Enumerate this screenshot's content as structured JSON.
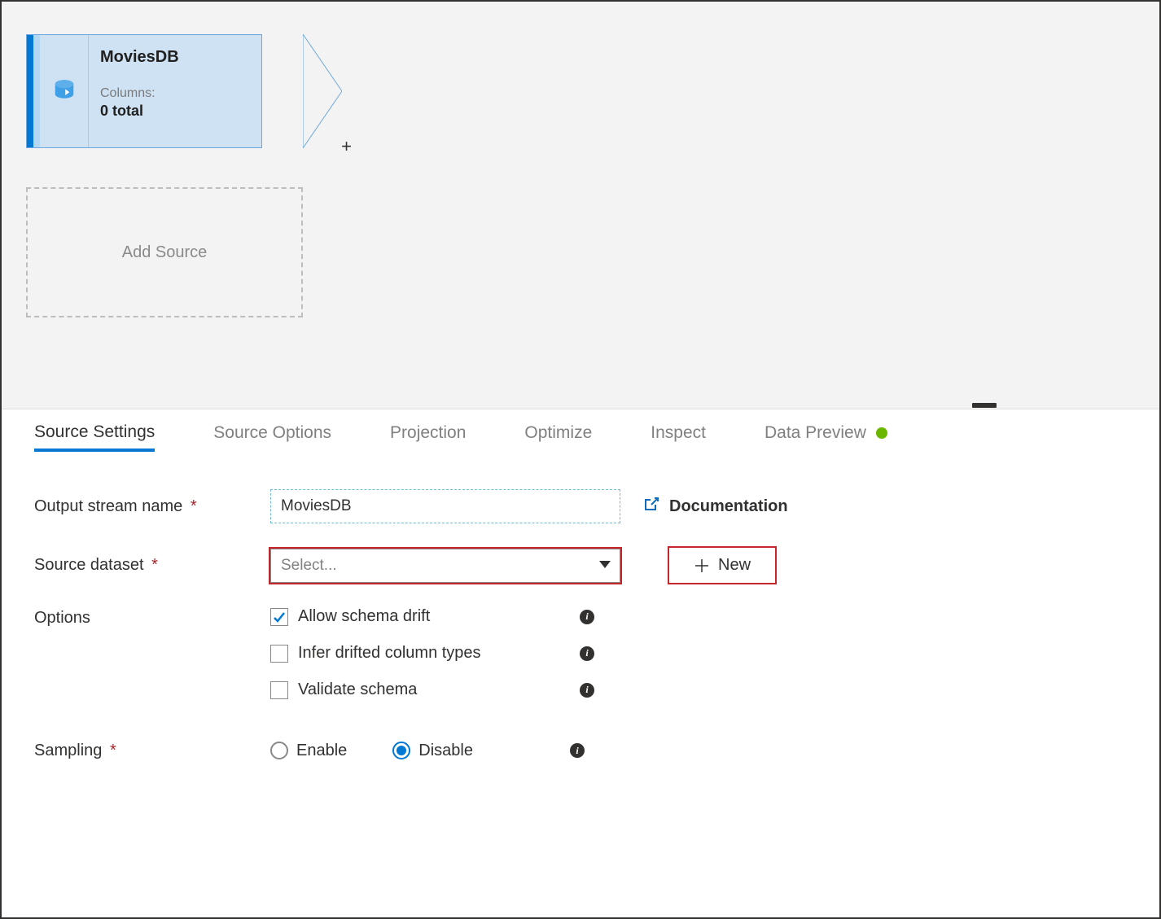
{
  "canvas": {
    "node": {
      "title": "MoviesDB",
      "columns_label": "Columns:",
      "columns_value": "0 total"
    },
    "add_source_label": "Add Source"
  },
  "tabs": {
    "source_settings": "Source Settings",
    "source_options": "Source Options",
    "projection": "Projection",
    "optimize": "Optimize",
    "inspect": "Inspect",
    "data_preview": "Data Preview"
  },
  "form": {
    "output_stream_label": "Output stream name",
    "output_stream_value": "MoviesDB",
    "source_dataset_label": "Source dataset",
    "source_dataset_placeholder": "Select...",
    "documentation_label": "Documentation",
    "new_button_label": "New",
    "options_label": "Options",
    "allow_schema_drift_label": "Allow schema drift",
    "infer_types_label": "Infer drifted column types",
    "validate_schema_label": "Validate schema",
    "sampling_label": "Sampling",
    "enable_label": "Enable",
    "disable_label": "Disable",
    "info_char": "i"
  }
}
